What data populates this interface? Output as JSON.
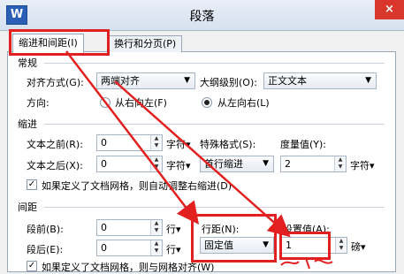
{
  "window": {
    "title": "段落",
    "app_icon": "W",
    "close": "×"
  },
  "tabs": [
    {
      "label": "缩进和间距(I)",
      "active": true
    },
    {
      "label": "换行和分页(P)",
      "active": false
    }
  ],
  "general": {
    "title": "常规",
    "alignment_label": "对齐方式(G):",
    "alignment_value": "两端对齐",
    "outline_label": "大纲级别(O):",
    "outline_value": "正文文本",
    "direction_label": "方向:",
    "direction_rtl": "从右向左(F)",
    "direction_ltr": "从左向右(L)"
  },
  "indent": {
    "title": "缩进",
    "before_label": "文本之前(R):",
    "before_value": "0",
    "before_unit": "字符▾",
    "after_label": "文本之后(X):",
    "after_value": "0",
    "after_unit": "字符▾",
    "special_label": "特殊格式(S):",
    "special_value": "首行缩进",
    "by_label": "度量值(Y):",
    "by_value": "2",
    "by_unit": "字符▾",
    "auto_adjust_label": "如果定义了文档网格，则自动调整右缩进(D)"
  },
  "spacing": {
    "title": "间距",
    "before_label": "段前(B):",
    "before_value": "0",
    "before_unit": "行▾",
    "after_label": "段后(E):",
    "after_value": "0",
    "after_unit": "行▾",
    "line_label": "行距(N):",
    "line_value": "固定值",
    "at_label": "设置值(A):",
    "at_value": "1",
    "at_unit": "磅▾",
    "snap_label": "如果定义了文档网格，则与网格对齐(W)"
  },
  "colors": {
    "highlight": "#e32020",
    "titlebar": "#dde6f2",
    "close": "#d9372b"
  }
}
